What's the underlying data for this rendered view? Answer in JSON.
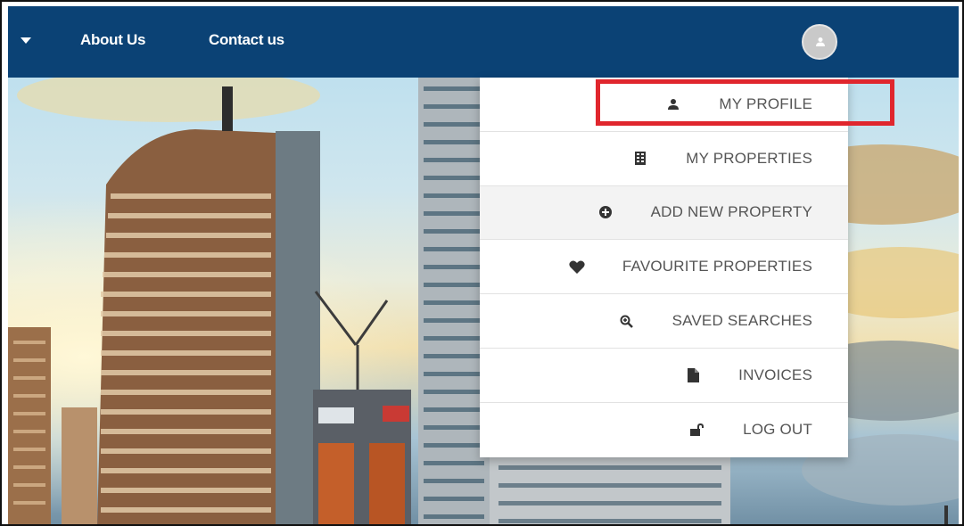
{
  "navbar": {
    "background_color": "#0b4275",
    "caret_icon": "caret-down-icon",
    "links": [
      {
        "label": "About Us"
      },
      {
        "label": "Contact us"
      }
    ],
    "avatar_icon": "user-avatar-icon"
  },
  "dropdown": {
    "items": [
      {
        "label": "MY PROFILE",
        "icon": "user-icon",
        "highlighted": true
      },
      {
        "label": "MY PROPERTIES",
        "icon": "building-icon"
      },
      {
        "label": "ADD NEW PROPERTY",
        "icon": "plus-circle-icon",
        "hovered": true
      },
      {
        "label": "FAVOURITE PROPERTIES",
        "icon": "heart-icon"
      },
      {
        "label": "SAVED SEARCHES",
        "icon": "search-plus-icon"
      },
      {
        "label": "INVOICES",
        "icon": "file-icon"
      },
      {
        "label": "LOG OUT",
        "icon": "unlock-icon"
      }
    ]
  },
  "highlight_color": "#e0262d"
}
